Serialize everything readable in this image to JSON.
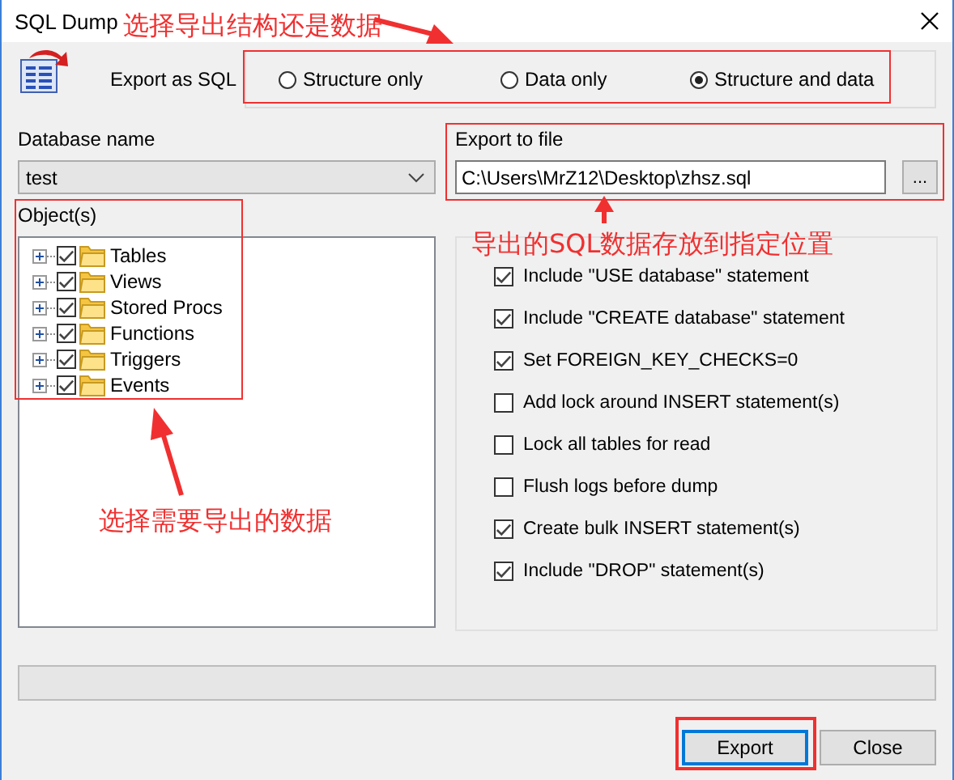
{
  "window": {
    "title": "SQL Dump"
  },
  "export_as": {
    "label": "Export as SQL",
    "options": [
      {
        "label": "Structure only",
        "selected": false
      },
      {
        "label": "Data only",
        "selected": false
      },
      {
        "label": "Structure and data",
        "selected": true
      }
    ]
  },
  "database": {
    "label": "Database name",
    "value": "test"
  },
  "export_file": {
    "label": "Export to file",
    "value": "C:\\Users\\MrZ12\\Desktop\\zhsz.sql",
    "browse": "..."
  },
  "objects": {
    "label": "Object(s)",
    "items": [
      {
        "label": "Tables",
        "checked": true
      },
      {
        "label": "Views",
        "checked": true
      },
      {
        "label": "Stored Procs",
        "checked": true
      },
      {
        "label": "Functions",
        "checked": true
      },
      {
        "label": "Triggers",
        "checked": true
      },
      {
        "label": "Events",
        "checked": true
      }
    ]
  },
  "options": [
    {
      "label": "Include \"USE database\" statement",
      "checked": true
    },
    {
      "label": "Include \"CREATE database\" statement",
      "checked": true
    },
    {
      "label": "Set FOREIGN_KEY_CHECKS=0",
      "checked": true
    },
    {
      "label": "Add lock around INSERT statement(s)",
      "checked": false
    },
    {
      "label": "Lock all tables for read",
      "checked": false
    },
    {
      "label": "Flush logs before dump",
      "checked": false
    },
    {
      "label": "Create bulk INSERT statement(s)",
      "checked": true
    },
    {
      "label": "Include \"DROP\" statement(s)",
      "checked": true
    }
  ],
  "progress": {
    "level": 0
  },
  "buttons": [
    {
      "label": "Export",
      "kind": "default"
    },
    {
      "label": "Close",
      "kind": "normal"
    }
  ],
  "annotations": [
    "选择导出结构还是数据",
    "导出的SQL数据存放到指定位置",
    "选择需要导出的数据"
  ]
}
